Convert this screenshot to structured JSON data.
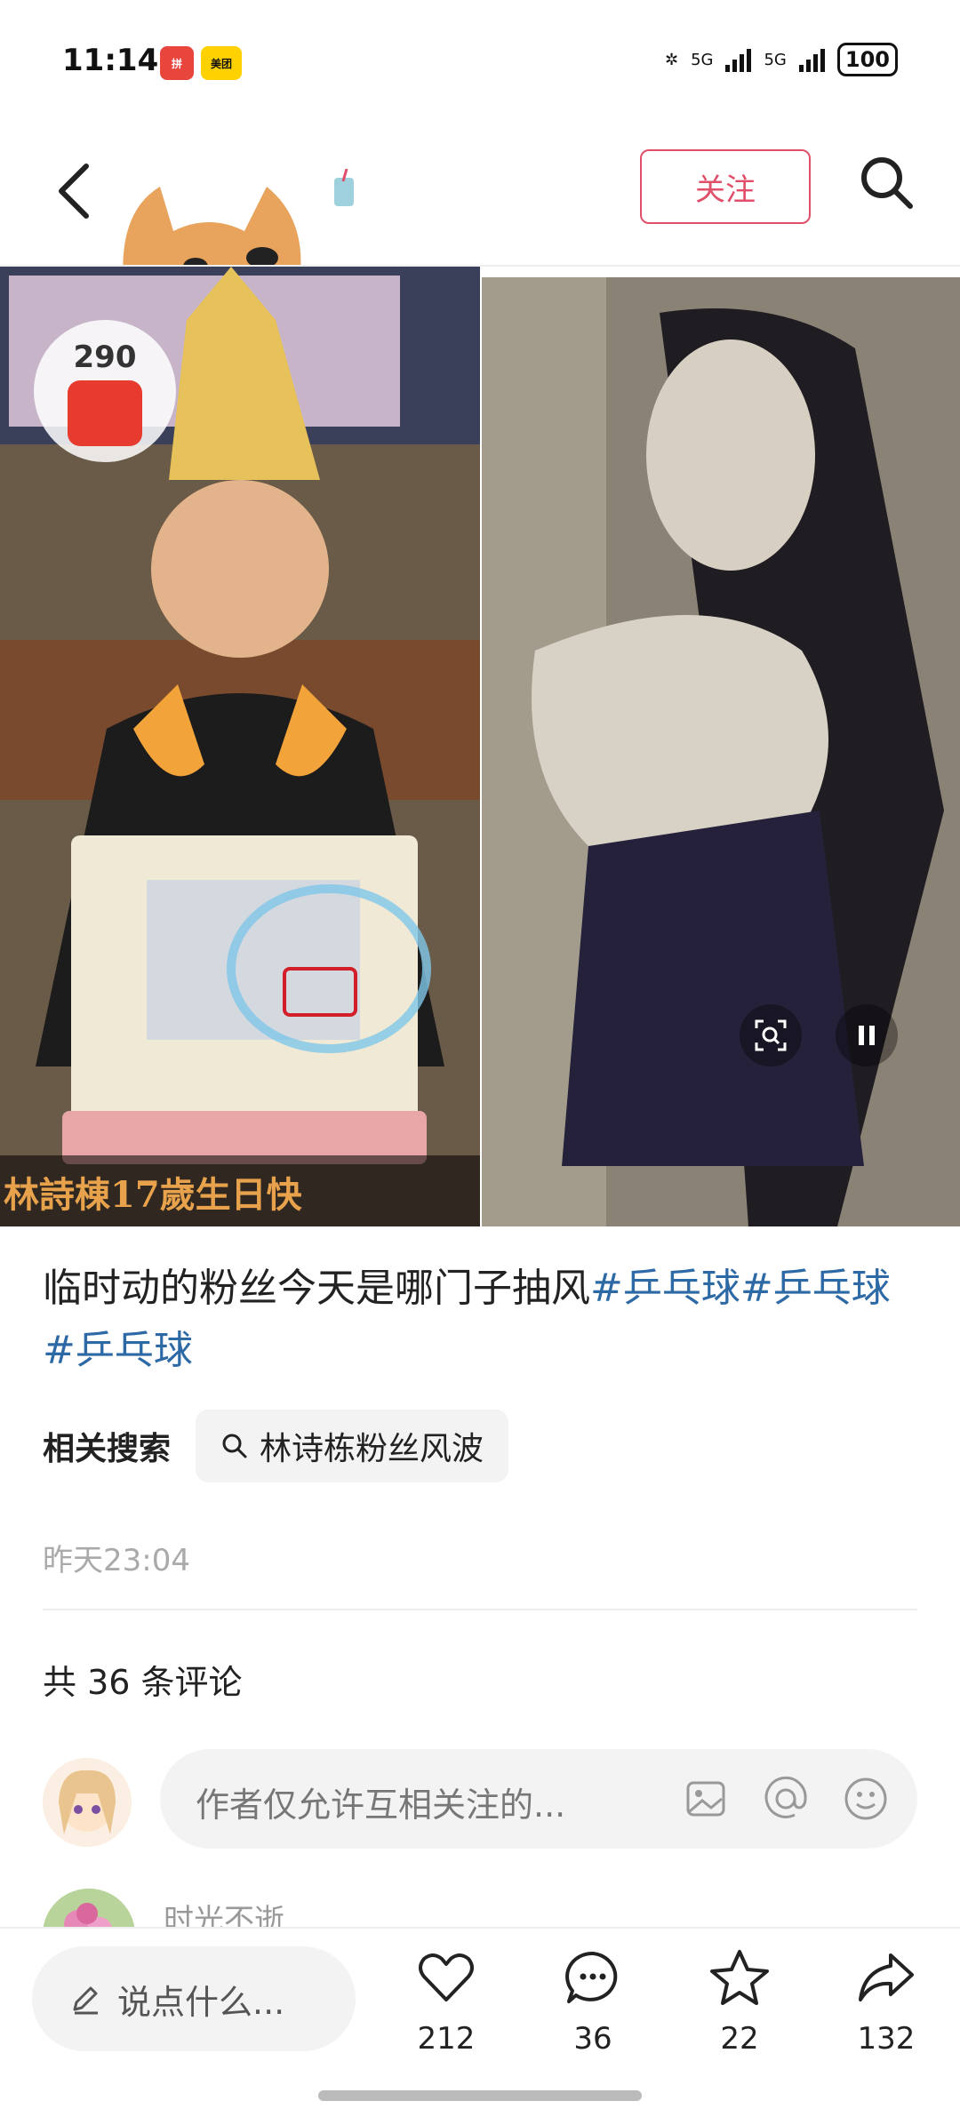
{
  "status_bar": {
    "time": "11:14",
    "app_badges": [
      "拼",
      "美团"
    ],
    "network": [
      "5G",
      "5G"
    ],
    "battery": "100"
  },
  "nav": {
    "follow_label": "关注"
  },
  "media": {
    "left_image": {
      "description_icon": "person-with-cake-photo",
      "caption": "林詩棟17歲生日快",
      "redpack_count": "290"
    },
    "right_image": {
      "description_icon": "cosplay-photo"
    }
  },
  "post": {
    "text_plain": "临时动的粉丝今天是哪门子抽风",
    "tags": [
      "#乒乓球",
      "#乒乓球",
      "#乒乓球"
    ],
    "related_label": "相关搜索",
    "related_query": "林诗栋粉丝风波",
    "timestamp": "昨天23:04"
  },
  "comments": {
    "count_label": "共 36 条评论",
    "input_placeholder": "作者仅允许互相关注的...",
    "preview_name": "时光不逝"
  },
  "bottom_bar": {
    "say_placeholder": "说点什么...",
    "likes": "212",
    "comments": "36",
    "favorites": "22",
    "shares": "132"
  },
  "colors": {
    "accent": "#e0506a",
    "tag": "#2d6aa5",
    "redpack": "#e83b2f"
  }
}
